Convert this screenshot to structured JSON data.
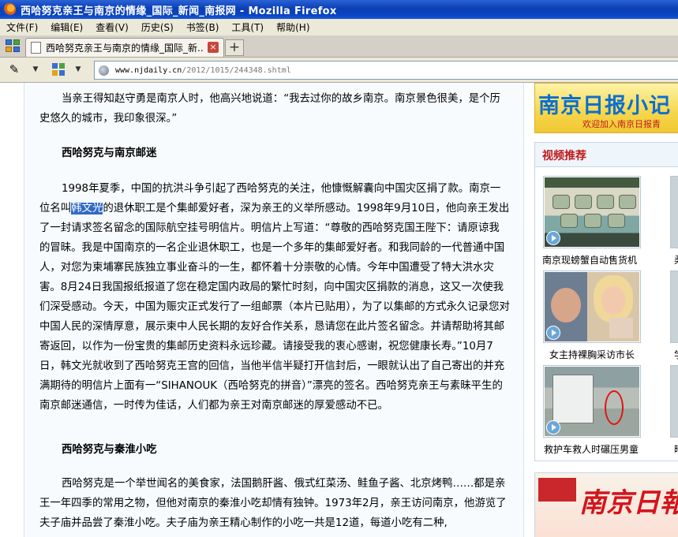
{
  "window": {
    "title": "西哈努克亲王与南京的情缘_国际_新闻_南报网 - Mozilla Firefox"
  },
  "menu": [
    "文件(F)",
    "编辑(E)",
    "查看(V)",
    "历史(S)",
    "书签(B)",
    "工具(T)",
    "帮助(H)"
  ],
  "tab": {
    "label": "西哈努克亲王与南京的情缘_国际_新...",
    "close_glyph": "×",
    "new_tab_glyph": "+"
  },
  "nav": {
    "url_host": "www.njdaily.cn",
    "url_path": "/2012/1015/244348.shtml"
  },
  "article": {
    "p1": "当亲王得知赵守勇是南京人时，他高兴地说道：“我去过你的故乡南京。南京景色很美，是个历史悠久的城市，我印象很深。”",
    "h1": "西哈努克与南京邮迷",
    "p2_before": "1998年夏季，中国的抗洪斗争引起了西哈努克的关注，他慷慨解囊向中国灾区捐了款。南京一位名叫",
    "p2_highlight": "韩文光",
    "p2_after": "的退休职工是个集邮爱好者，深为亲王的义举所感动。1998年9月10日，他向亲王发出了一封请求签名留念的国际航空挂号明信片。明信片上写道：“尊敬的西哈努克国王陛下：请原谅我的冒昧。我是中国南京的一名企业退休职工，也是一个多年的集邮爱好者。和我同龄的一代普通中国人，对您为柬埔寨民族独立事业奋斗的一生，都怀着十分崇敬的心情。今年中国遭受了特大洪水灾害。8月24日我国报纸报道了您在稳定国内政局的繁忙时刻，向中国灾区捐款的消息，这又一次使我们深受感动。今天，中国为赈灾正式发行了一组邮票（本片已贴用），为了以集邮的方式永久记录您对中国人民的深情厚意，展示柬中人民长期的友好合作关系，恳请您在此片签名留念。并请帮助将其邮寄返回，以作为一份宝贵的集邮历史资料永远珍藏。请接受我的衷心感谢，祝您健康长寿。”10月7日，韩文光就收到了西哈努克王宫的回信，当他半信半疑打开信封后，一眼就认出了自己寄出的并充满期待的明信片上面有一“SIHANOUK（西哈努克的拼音）”漂亮的签名。西哈努克亲王与素昧平生的南京邮迷通信，一时传为佳话，人们都为亲王对南京邮迷的厚爱感动不已。",
    "h2": "西哈努克与秦淮小吃",
    "p3": "西哈努克是一个举世闻名的美食家，法国鹅肝酱、俄式红菜汤、鲑鱼子酱、北京烤鸭……都是亲王一年四季的常用之物，但他对南京的秦淮小吃却情有独钟。1973年2月，亲王访问南京，他游览了夫子庙并品尝了秦淮小吃。夫子庙为亲王精心制作的小吃一共是12道，每道小吃有二种,"
  },
  "sidebar": {
    "banner_title": "南京日报小记",
    "banner_sub": "欢迎加入南京日报青",
    "video_title": "视频推荐",
    "captions": [
      "南京现螃蟹自动售货机",
      "女主持裸胸采访市长",
      "救护车救人时碾压男童"
    ],
    "edge_captions": [
      "柔",
      "学",
      "暗"
    ],
    "bottom_banner": "南京日報"
  }
}
